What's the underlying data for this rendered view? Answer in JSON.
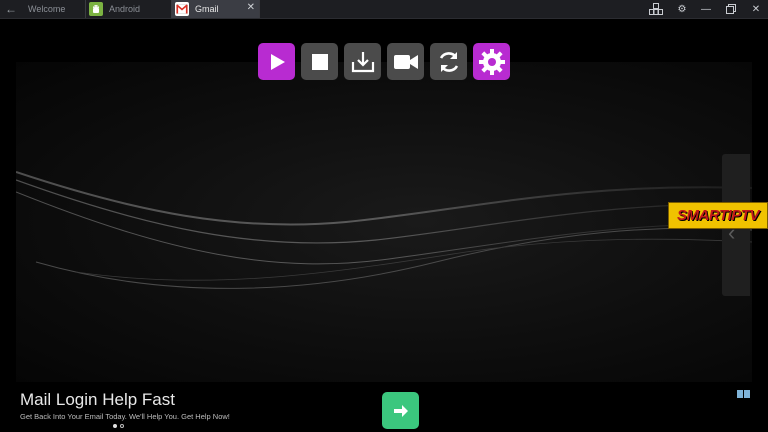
{
  "tabs": [
    {
      "label": "Welcome",
      "icon": "none"
    },
    {
      "label": "Android",
      "icon": "android-icon"
    },
    {
      "label": "Gmail",
      "icon": "gmail-icon",
      "active": true
    }
  ],
  "window_controls": [
    "keymap-icon",
    "settings-icon",
    "minimize-icon",
    "restore-icon",
    "close-icon"
  ],
  "toolbar": {
    "buttons": [
      {
        "name": "play",
        "icon": "play-icon",
        "color": "#b82bd1"
      },
      {
        "name": "stop",
        "icon": "stop-icon",
        "color": "#4b4b4b"
      },
      {
        "name": "download",
        "icon": "download-icon",
        "color": "#4b4b4b"
      },
      {
        "name": "record",
        "icon": "video-camera-icon",
        "color": "#4b4b4b"
      },
      {
        "name": "refresh",
        "icon": "refresh-icon",
        "color": "#4b4b4b"
      },
      {
        "name": "settings",
        "icon": "gear-icon",
        "color": "#b82bd1"
      }
    ]
  },
  "logo": {
    "text": "SMARTIPTV"
  },
  "ad": {
    "title": "Mail Login Help Fast",
    "subtitle": "Get Back Into Your Email Today. We'll Help You. Get Help Now!",
    "pages": 2,
    "current_page": 1,
    "button_color": "#3bc77e"
  }
}
